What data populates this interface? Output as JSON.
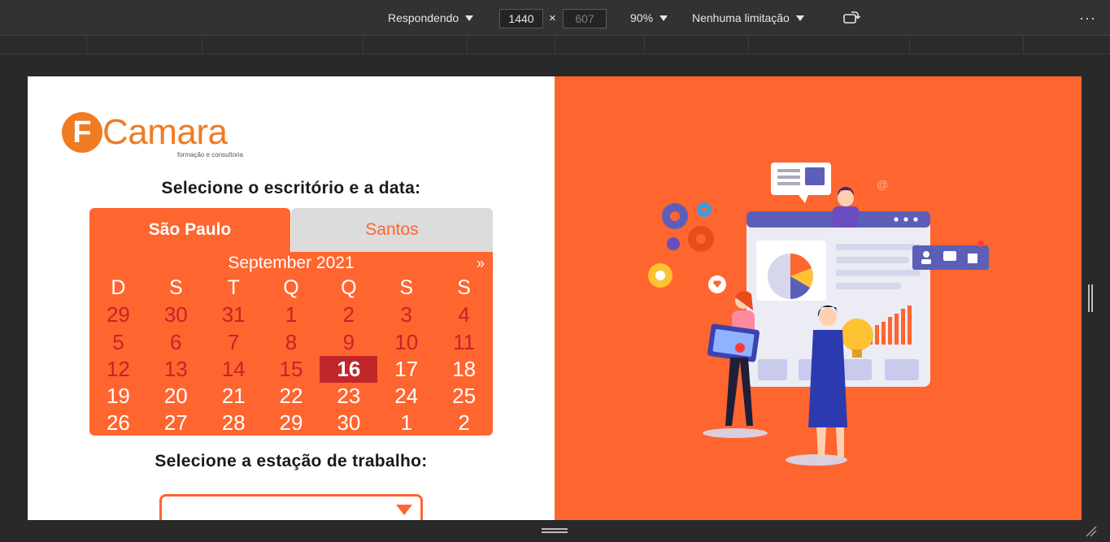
{
  "devtools": {
    "mode_label": "Respondendo",
    "width": "1440",
    "times": "×",
    "height": "607",
    "zoom": "90%",
    "throttle": "Nenhuma limitação",
    "more": "···"
  },
  "logo": {
    "letter": "F",
    "name": "Camara",
    "tagline": "formação e consultoria"
  },
  "booking": {
    "office_heading": "Selecione o escritório e a data:",
    "tabs": [
      {
        "label": "São Paulo",
        "selected": true
      },
      {
        "label": "Santos",
        "selected": false
      }
    ],
    "calendar": {
      "month": "September 2021",
      "next": "»",
      "weekdays": [
        "D",
        "S",
        "T",
        "Q",
        "Q",
        "S",
        "S"
      ],
      "weeks": [
        [
          "29",
          "30",
          "31",
          "1",
          "2",
          "3",
          "4"
        ],
        [
          "5",
          "6",
          "7",
          "8",
          "9",
          "10",
          "11"
        ],
        [
          "12",
          "13",
          "14",
          "15",
          "16",
          "17",
          "18"
        ],
        [
          "19",
          "20",
          "21",
          "22",
          "23",
          "24",
          "25"
        ],
        [
          "26",
          "27",
          "28",
          "29",
          "30",
          "1",
          "2"
        ]
      ],
      "selected": "16"
    },
    "workstation_heading": "Selecione a estação de trabalho:",
    "workstation_value": ""
  },
  "colors": {
    "brand_orange": "#ff652f",
    "logo_orange": "#ef7b22",
    "past_day_red": "#c0262a"
  }
}
